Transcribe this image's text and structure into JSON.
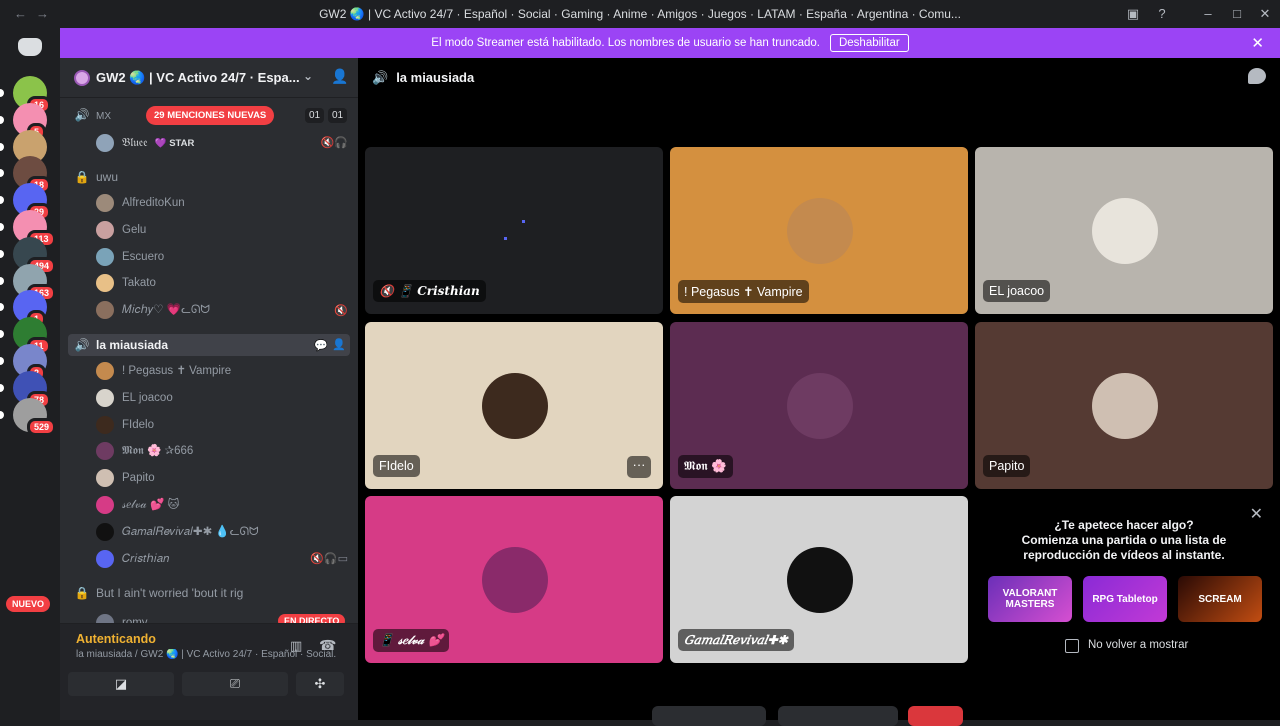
{
  "window": {
    "title": "GW2 🌏 | VC Activo 24/7 · Español · Social · Gaming · Anime · Amigos · Juegos · LATAM · España · Argentina · Comu..."
  },
  "banner": {
    "text": "El modo Streamer está habilitado. Los nombres de usuario se han truncado.",
    "button": "Deshabilitar"
  },
  "servers": [
    {
      "badge": "16"
    },
    {
      "badge": "5"
    },
    {
      "badge": ""
    },
    {
      "badge": "18"
    },
    {
      "badge": "29"
    },
    {
      "badge": "113"
    },
    {
      "badge": "494"
    },
    {
      "badge": "163"
    },
    {
      "badge": "1"
    },
    {
      "badge": "11"
    },
    {
      "badge": "2"
    },
    {
      "badge": "78"
    },
    {
      "badge": "529"
    }
  ],
  "rail": {
    "nuevo": "NUEVO"
  },
  "guild": {
    "name": "GW2 🌏 | VC Activo 24/7 · Espa..."
  },
  "sidebar": {
    "mx": {
      "name": "MX",
      "mentions": "29 MENCIONES NUEVAS",
      "count_a": "01",
      "count_b": "01"
    },
    "mx_users": [
      {
        "name": "𝔅𝔩𝔲𝔢𝔢",
        "tag": "💜 STAR"
      }
    ],
    "uwu": {
      "name": "uwu"
    },
    "uwu_users": [
      "AlfreditoKun",
      "Gelu",
      "Escuero",
      "Takato",
      "𝑀𝑖𝑐ℎ𝑦♡ 💗ᓚᘏᗢ"
    ],
    "miau": {
      "name": "la miausiada"
    },
    "miau_users": [
      "! Pegasus ✝ Vampire",
      "EL joacoo",
      "FIdelo",
      "𝕸𝖔𝖓 🌸 ✰666",
      "Papito",
      "𝓈𝑒𝓁𝓋𝒶 💕 🐱",
      "𝐺𝑎𝑚𝑎𝑙𝑅𝑒𝑣𝑖𝑣𝑎𝑙✚✱ 💧ᓚᘏᗢ",
      "𝐶𝑟𝑖𝑠𝑡ℎ𝑖𝑎𝑛"
    ],
    "last_channel": "But I ain't worried 'bout it rig",
    "last_user": "romy",
    "live": "EN DIRECTO"
  },
  "voice": {
    "status": "Autenticando",
    "sub": "la miausiada / GW2 🌏 | VC Activo 24/7 · Español · Social..."
  },
  "main": {
    "channel": "la miausiada"
  },
  "tiles": [
    {
      "name": "🔇 📱 𝑪𝒓𝒊𝒔𝒕𝒉𝒊𝒂𝒏",
      "bg": "#1e1f22",
      "avatar": ""
    },
    {
      "name": "! Pegasus ✝ Vampire",
      "bg": "#d4903f",
      "avatar": "#c48a4e"
    },
    {
      "name": "EL joacoo",
      "bg": "#b8b4ad",
      "avatar": "#e8e4dc"
    },
    {
      "name": "FIdelo",
      "bg": "#e2d5bf",
      "avatar": "#3d2a1e"
    },
    {
      "name": "𝕸𝖔𝖓 🌸",
      "bg": "#5c2c51",
      "avatar": "#6e3b62"
    },
    {
      "name": "Papito",
      "bg": "#553a33",
      "avatar": "#cfbfb2"
    },
    {
      "name": "📱 𝓈𝑒𝓁𝓋𝒶 💕",
      "bg": "#d63b86",
      "avatar": "#8a2a6a"
    },
    {
      "name": "𝐺𝑎𝑚𝑎𝑙𝑅𝑒𝑣𝑖𝑣𝑎𝑙✚✱",
      "bg": "#d3d3d3",
      "avatar": "#111111"
    }
  ],
  "activity": {
    "line1": "¿Te apetece hacer algo?",
    "line2": "Comienza una partida o una lista de",
    "line3": "reproducción de vídeos al instante.",
    "cards": [
      "VALORANT MASTERS",
      "RPG Tabletop",
      "SCREAM"
    ],
    "checkbox": "No volver a mostrar"
  }
}
